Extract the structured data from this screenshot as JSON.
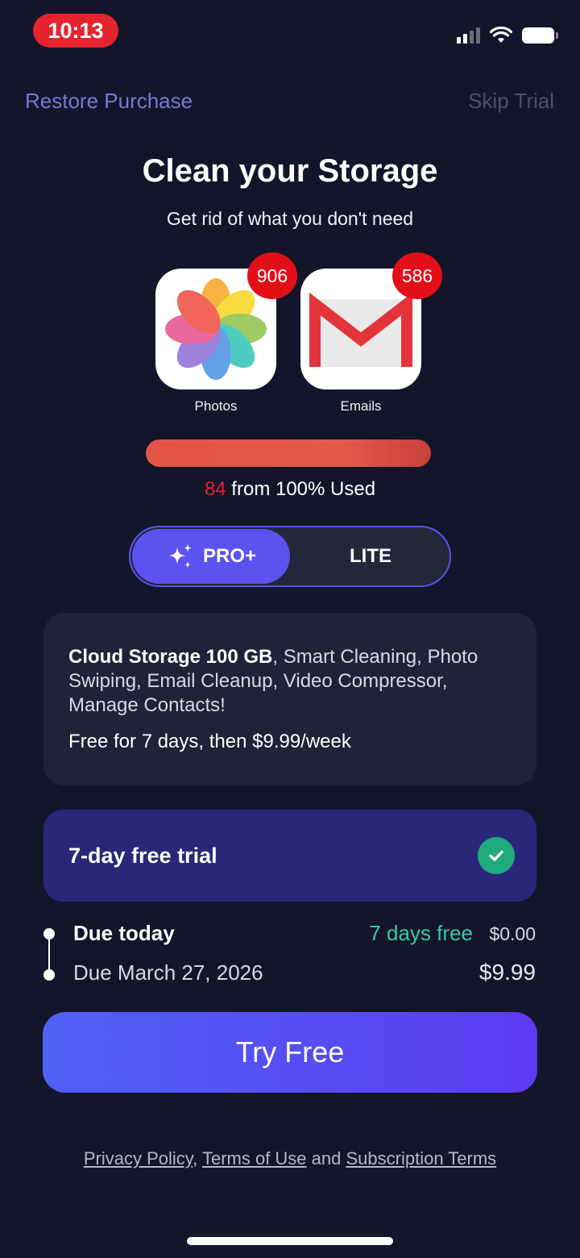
{
  "status_bar": {
    "time": "10:13"
  },
  "top_bar": {
    "restore_label": "Restore Purchase",
    "skip_label": "Skip Trial"
  },
  "hero": {
    "title": "Clean your Storage",
    "subtitle": "Get rid of what you don't need"
  },
  "apps": [
    {
      "label": "Photos",
      "badge": "906",
      "icon": "photos-icon"
    },
    {
      "label": "Emails",
      "badge": "586",
      "icon": "gmail-icon"
    }
  ],
  "storage": {
    "used_value": "84",
    "used_suffix": " from 100% Used",
    "fill_percent": 100
  },
  "plan_toggle": {
    "pro_label": "PRO+",
    "lite_label": "LITE",
    "selected": "PRO+"
  },
  "feature_card": {
    "highlight": "Cloud Storage 100 GB",
    "rest": ", Smart Cleaning, Photo Swiping, Email Cleanup, Video Compressor, Manage Contacts!",
    "price_text": "Free for 7 days, then $9.99/week"
  },
  "trial_option": {
    "label": "7-day free trial",
    "selected": true
  },
  "schedule": {
    "today_label": "Due today",
    "today_free": "7 days free",
    "today_price": "$0.00",
    "later_label": "Due March 27, 2026",
    "later_price": "$9.99"
  },
  "cta": {
    "label": "Try Free"
  },
  "legal": {
    "privacy": "Privacy Policy",
    "comma": ", ",
    "terms": "Terms of Use",
    "and": " and ",
    "subscription": "Subscription Terms"
  },
  "colors": {
    "background": "#13162a",
    "accent": "#5b52ef",
    "badge_red": "#e30f18",
    "success_green": "#1faa7e",
    "free_text": "#3cc7a6"
  }
}
